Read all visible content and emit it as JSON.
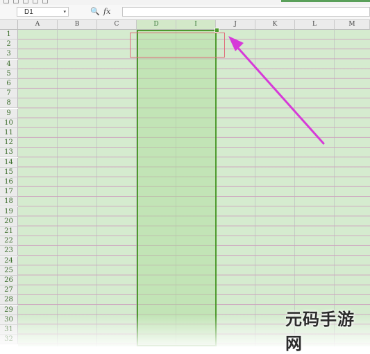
{
  "toolbar": {},
  "formula_bar": {
    "name_box": "D1",
    "name_box_caret": "▾",
    "zoom_icon": "magnifier-icon",
    "zoom_glyph": "🔍",
    "fx_label": "fx",
    "formula_value": ""
  },
  "columns": [
    "A",
    "B",
    "C",
    "D",
    "I",
    "J",
    "K",
    "L",
    "M"
  ],
  "selected_columns": [
    "D",
    "I"
  ],
  "rows": [
    "1",
    "2",
    "3",
    "4",
    "5",
    "6",
    "7",
    "8",
    "9",
    "10",
    "11",
    "12",
    "13",
    "14",
    "15",
    "16",
    "17",
    "18",
    "19",
    "20",
    "21",
    "22",
    "23",
    "24",
    "25",
    "26",
    "27",
    "28",
    "29",
    "30",
    "31",
    "32"
  ],
  "annotation": {
    "arrow_color": "#d63ad8",
    "highlight_color": "#e06a7a"
  },
  "watermark": {
    "text": "元码手游网"
  }
}
